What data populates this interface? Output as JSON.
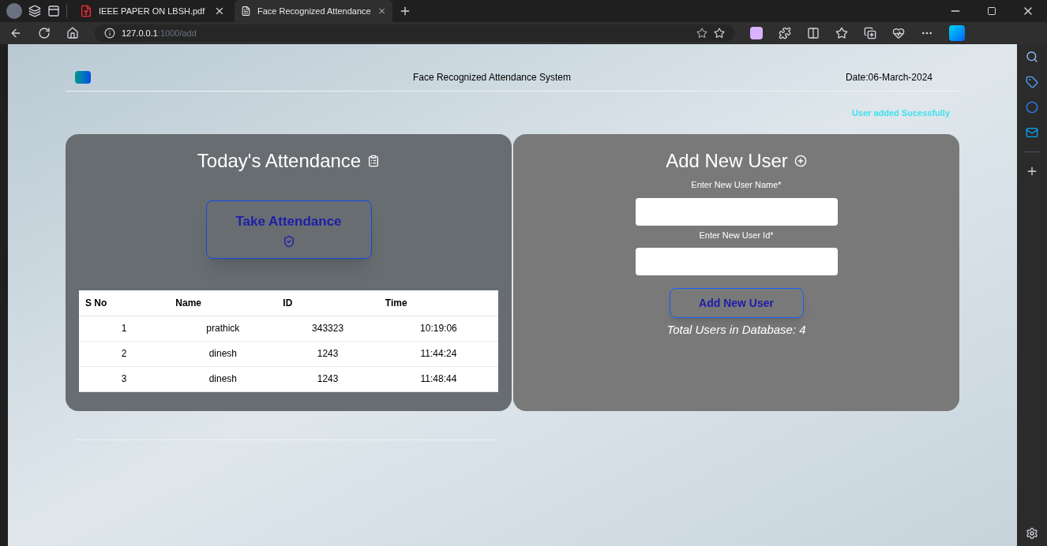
{
  "browser": {
    "tabs": [
      {
        "title": "IEEE PAPER ON LBSH.pdf",
        "kind": "pdf",
        "selected": false
      },
      {
        "title": "Face Recognized Attendance",
        "kind": "page",
        "selected": true
      }
    ],
    "address": {
      "host": "127.0.0.1",
      "path": ":1000/add"
    }
  },
  "header": {
    "title": "Face Recognized Attendance System",
    "date": "Date:06-March-2024"
  },
  "flash": "User added Sucessfully",
  "attendance": {
    "heading": "Today's Attendance",
    "button": "Take Attendance",
    "columns": [
      "S No",
      "Name",
      "ID",
      "Time"
    ],
    "rows": [
      [
        "1",
        "prathick",
        "343323",
        "10:19:06"
      ],
      [
        "2",
        "dinesh",
        "1243",
        "11:44:24"
      ],
      [
        "3",
        "dinesh",
        "1243",
        "11:48:44"
      ]
    ]
  },
  "add_user": {
    "heading": "Add New User",
    "fields": [
      {
        "label": "Enter New User Name*"
      },
      {
        "label": "Enter New User Id*"
      }
    ],
    "button": "Add New User",
    "total": "Total Users in Database: 4"
  }
}
